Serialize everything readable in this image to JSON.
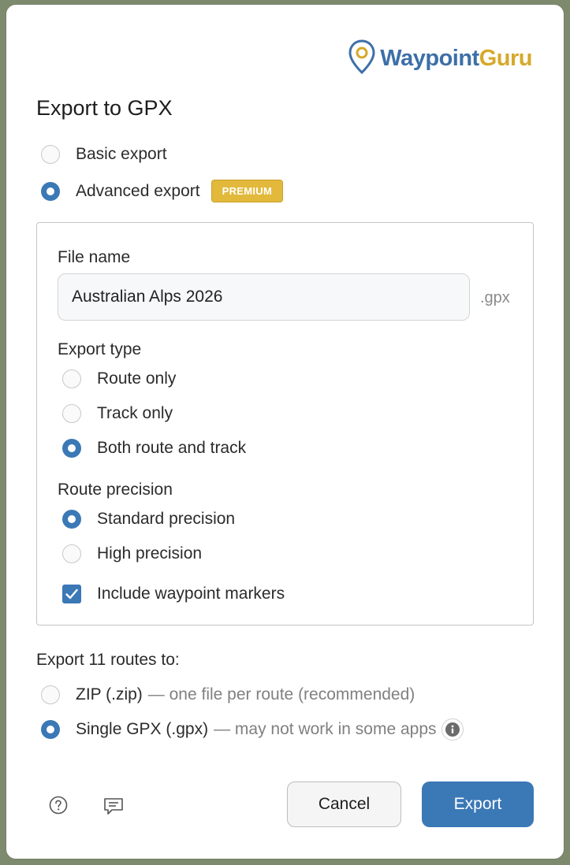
{
  "brand": {
    "name_part1": "Waypoint",
    "name_part2": "Guru"
  },
  "title": "Export to GPX",
  "export_mode": {
    "options": [
      {
        "label": "Basic export",
        "selected": false
      },
      {
        "label": "Advanced export",
        "selected": true,
        "badge": "PREMIUM"
      }
    ]
  },
  "advanced": {
    "file_name_label": "File name",
    "file_name_value": "Australian Alps 2026",
    "file_suffix": ".gpx",
    "export_type_label": "Export type",
    "export_type_options": [
      {
        "label": "Route only",
        "selected": false
      },
      {
        "label": "Track only",
        "selected": false
      },
      {
        "label": "Both route and track",
        "selected": true
      }
    ],
    "precision_label": "Route precision",
    "precision_options": [
      {
        "label": "Standard precision",
        "selected": true
      },
      {
        "label": "High precision",
        "selected": false
      }
    ],
    "waypoint_markers_label": "Include waypoint markers",
    "waypoint_markers_checked": true
  },
  "destination": {
    "label": "Export 11 routes to:",
    "options": [
      {
        "label": "ZIP (.zip)",
        "hint": "— one file per route (recommended)",
        "selected": false
      },
      {
        "label": "Single GPX (.gpx)",
        "hint": "— may not work in some apps",
        "selected": true
      }
    ]
  },
  "footer": {
    "cancel_label": "Cancel",
    "export_label": "Export"
  },
  "colors": {
    "accent": "#3b78b6",
    "premium": "#e2b93b",
    "brand_blue": "#3d6fa8",
    "brand_gold": "#d6a92a"
  },
  "icons": [
    "map-pin-icon",
    "help-icon",
    "feedback-icon",
    "info-icon",
    "checkmark-icon"
  ]
}
